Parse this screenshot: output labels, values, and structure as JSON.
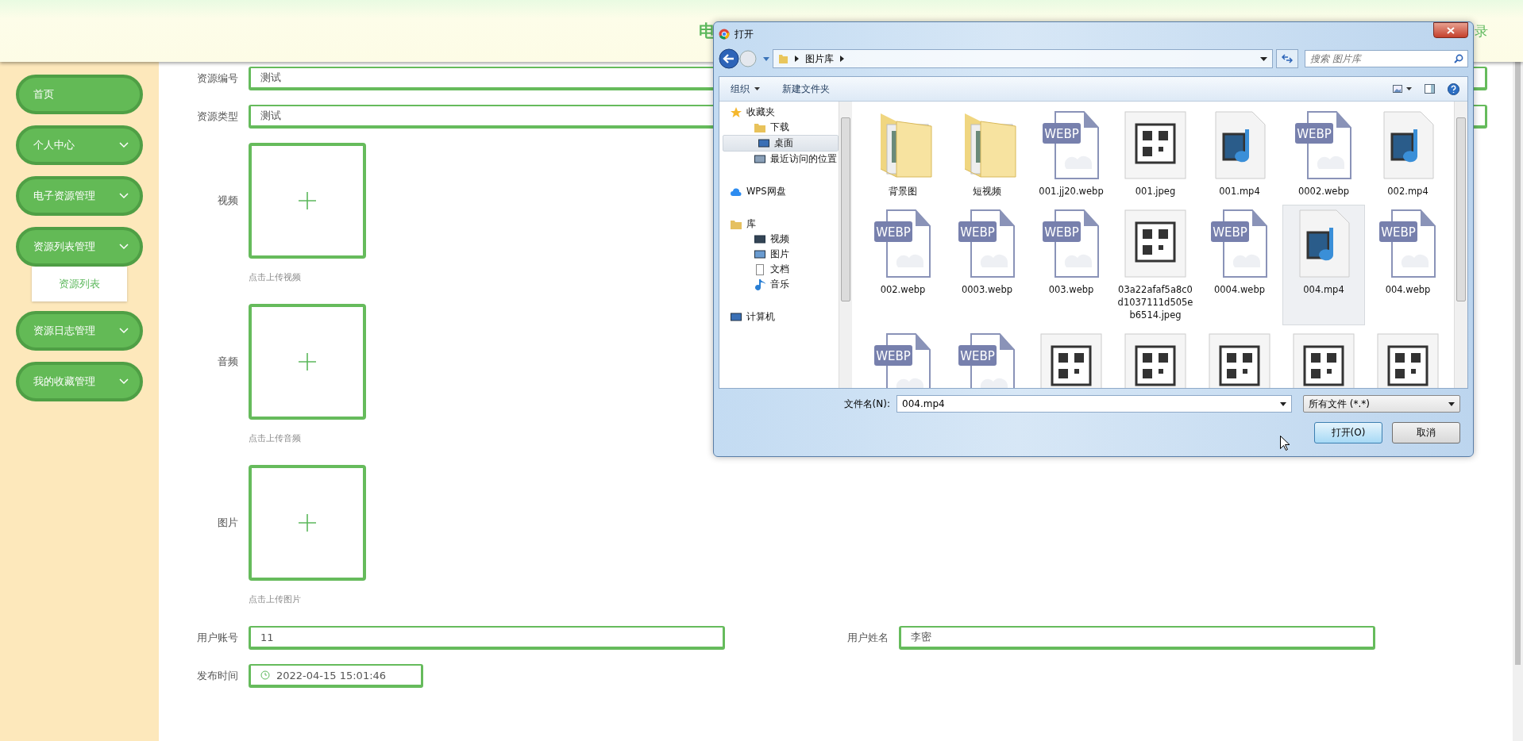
{
  "header": {
    "title_visible": "电",
    "right_visible": "录"
  },
  "sidebar": {
    "items": [
      {
        "label": "首页",
        "kind": "link"
      },
      {
        "label": "个人中心",
        "kind": "submenu"
      },
      {
        "label": "电子资源管理",
        "kind": "submenu"
      },
      {
        "label": "资源列表管理",
        "kind": "submenu",
        "children": [
          {
            "label": "资源列表"
          }
        ]
      },
      {
        "label": "资源日志管理",
        "kind": "submenu"
      },
      {
        "label": "我的收藏管理",
        "kind": "submenu"
      }
    ]
  },
  "form": {
    "rows": [
      [
        {
          "kind": "text",
          "label": "资源编号",
          "value": "测试"
        }
      ],
      [
        {
          "kind": "text",
          "label": "资源类型",
          "value": "测试"
        }
      ],
      [
        {
          "kind": "upload",
          "label": "视频",
          "hint": "点击上传视频"
        }
      ],
      [
        {
          "kind": "upload",
          "label": "音频",
          "hint": "点击上传音频"
        }
      ],
      [
        {
          "kind": "upload",
          "label": "图片",
          "hint": "点击上传图片"
        }
      ],
      [
        {
          "kind": "text",
          "label": "用户账号",
          "value": "11"
        },
        {
          "kind": "text",
          "label": "用户姓名",
          "value": "李密"
        }
      ],
      [
        {
          "kind": "datetime",
          "label": "发布时间",
          "value": "2022-04-15 15:01:46"
        }
      ]
    ]
  },
  "dialog": {
    "title": "打开",
    "breadcrumb": "图片库",
    "search": {
      "placeholder": "搜索 图片库"
    },
    "toolbar": [
      "组织",
      "新建文件夹"
    ],
    "nav": [
      {
        "label": "收藏夹",
        "kind": "favorites",
        "selected": false,
        "children": [
          {
            "label": "下载",
            "kind": "download",
            "selected": false
          },
          {
            "label": "桌面",
            "kind": "desktop",
            "selected": true
          },
          {
            "label": "最近访问的位置",
            "kind": "recent",
            "selected": false
          }
        ]
      },
      {
        "label": "WPS网盘",
        "kind": "cloud",
        "selected": false
      },
      {
        "label": "库",
        "kind": "library",
        "selected": false,
        "children": [
          {
            "label": "视频",
            "kind": "video",
            "selected": false
          },
          {
            "label": "图片",
            "kind": "picture",
            "selected": false
          },
          {
            "label": "文档",
            "kind": "document",
            "selected": false
          },
          {
            "label": "音乐",
            "kind": "music",
            "selected": false
          }
        ]
      },
      {
        "label": "计算机",
        "kind": "computer",
        "selected": false
      }
    ],
    "files": [
      {
        "name": "背景图",
        "kind": "folder",
        "selected": false
      },
      {
        "name": "短视频",
        "kind": "folder",
        "selected": false
      },
      {
        "name": "001.jj20.webp",
        "kind": "webp",
        "badge": "WEBP",
        "selected": false
      },
      {
        "name": "001.jpeg",
        "kind": "image",
        "selected": false
      },
      {
        "name": "001.mp4",
        "kind": "video",
        "selected": false
      },
      {
        "name": "0002.webp",
        "kind": "webp",
        "badge": "WEBP",
        "selected": false
      },
      {
        "name": "002.mp4",
        "kind": "video",
        "selected": false
      },
      {
        "name": "002.webp",
        "kind": "webp",
        "badge": "WEBP",
        "selected": false
      },
      {
        "name": "0003.webp",
        "kind": "webp",
        "badge": "WEBP",
        "selected": false
      },
      {
        "name": "003.webp",
        "kind": "webp",
        "badge": "WEBP",
        "selected": false
      },
      {
        "name": "03a22afaf5a8c0d1037111d505eb6514.jpeg",
        "kind": "image",
        "selected": false
      },
      {
        "name": "0004.webp",
        "kind": "webp",
        "badge": "WEBP",
        "selected": false
      },
      {
        "name": "004.mp4",
        "kind": "video",
        "selected": true
      },
      {
        "name": "004.webp",
        "kind": "webp",
        "badge": "WEBP",
        "selected": false
      },
      {
        "kind": "webp",
        "badge": "WEBP",
        "selected": false
      },
      {
        "kind": "webp",
        "badge": "WEBP",
        "selected": false
      },
      {
        "kind": "image",
        "selected": false
      },
      {
        "kind": "image",
        "selected": false
      },
      {
        "kind": "image",
        "selected": false
      },
      {
        "kind": "image",
        "selected": false
      },
      {
        "kind": "image",
        "selected": false
      }
    ],
    "filename_label": "文件名(N):",
    "filename": "004.mp4",
    "filetype": "所有文件 (*.*)",
    "buttons": [
      "打开(O)",
      "取消"
    ]
  }
}
